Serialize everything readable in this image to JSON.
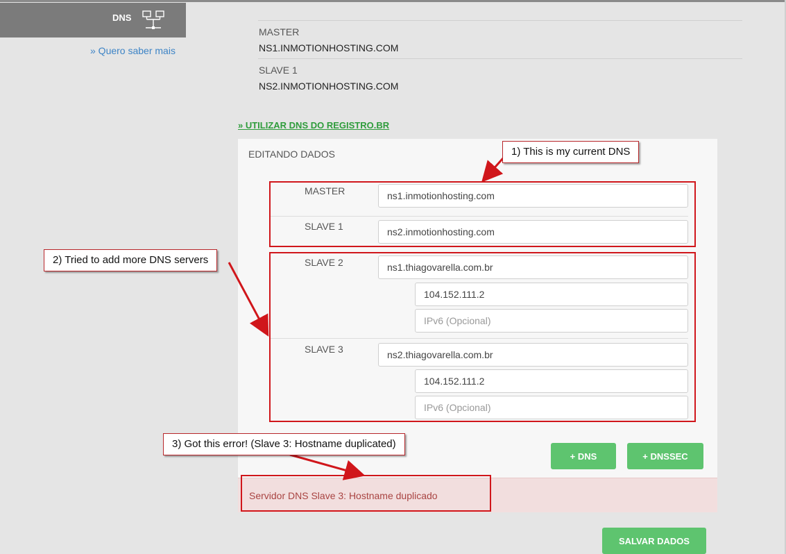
{
  "sidebar": {
    "dns_label": "DNS",
    "dns_icon": "network-servers-icon",
    "learn_more": "» Quero saber mais"
  },
  "current": [
    {
      "key": "MASTER",
      "value": "NS1.INMOTIONHOSTING.COM"
    },
    {
      "key": "SLAVE 1",
      "value": "NS2.INMOTIONHOSTING.COM"
    }
  ],
  "use_registro_link": "» UTILIZAR DNS DO REGISTRO.BR",
  "edit": {
    "title": "EDITANDO DADOS",
    "master": {
      "label": "MASTER",
      "hostname": "ns1.inmotionhosting.com"
    },
    "slave1": {
      "label": "SLAVE 1",
      "hostname": "ns2.inmotionhosting.com"
    },
    "slave2": {
      "label": "SLAVE 2",
      "hostname": "ns1.thiagovarella.com.br",
      "ipv4": "104.152.111.2",
      "ipv6_placeholder": "IPv6 (Opcional)"
    },
    "slave3": {
      "label": "SLAVE 3",
      "hostname": "ns2.thiagovarella.com.br",
      "ipv4": "104.152.111.2",
      "ipv6_placeholder": "IPv6 (Opcional)"
    }
  },
  "buttons": {
    "add_dns": "+ DNS",
    "add_dnssec": "+ DNSSEC",
    "save": "SALVAR DADOS"
  },
  "error_message": "Servidor DNS Slave 3: Hostname duplicado",
  "annotations": {
    "one": "1) This is my current DNS",
    "two": "2) Tried to add more DNS servers",
    "three": "3) Got this error! (Slave 3: Hostname duplicated)",
    "color": "#d0161b"
  },
  "colors": {
    "accent_green": "#5ec46f",
    "link_green": "#2e9c3b",
    "link_blue": "#3d84c6",
    "error_text": "#a94442",
    "error_bg": "#f2dede"
  }
}
